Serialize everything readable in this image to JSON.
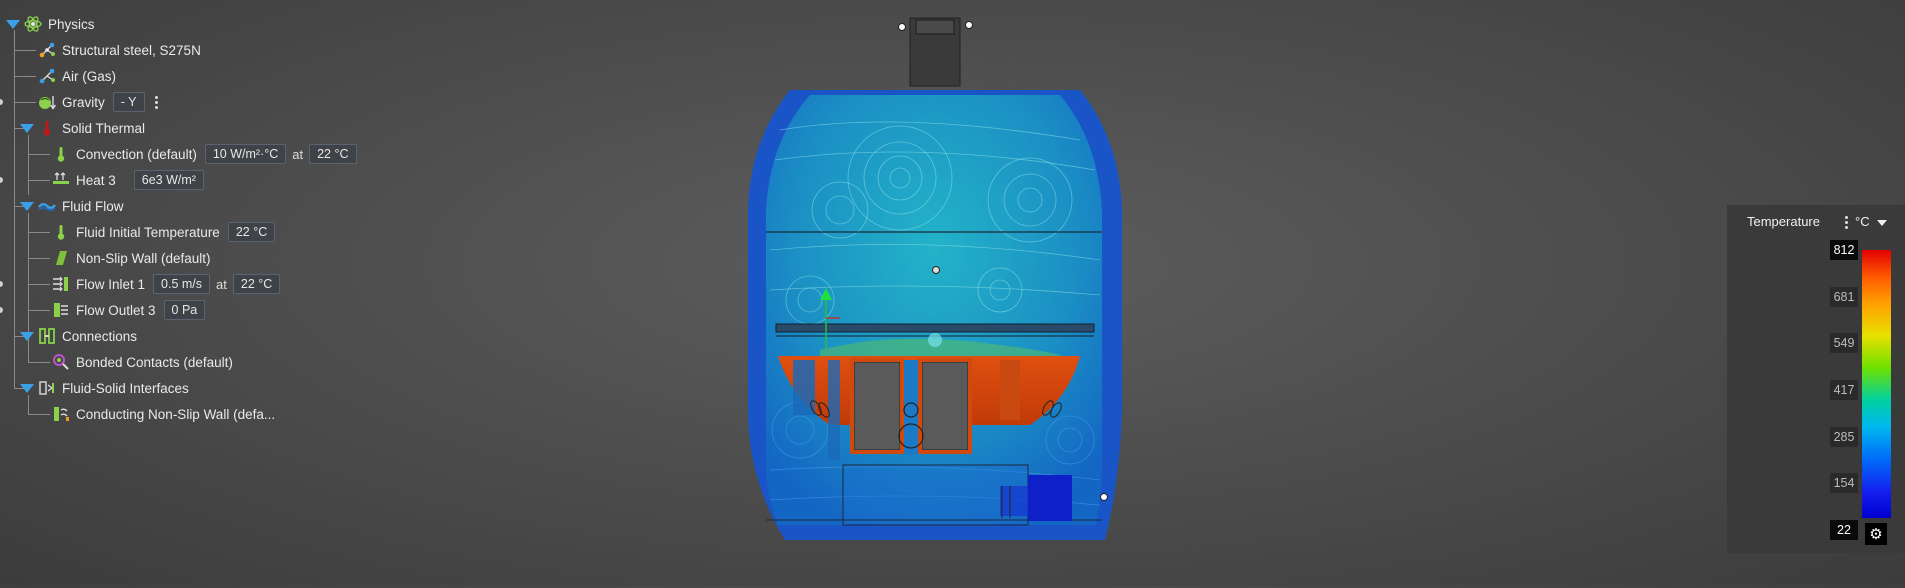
{
  "tree": {
    "physics": {
      "label": "Physics"
    },
    "steel": {
      "label": "Structural steel, S275N"
    },
    "air": {
      "label": "Air (Gas)"
    },
    "gravity": {
      "label": "Gravity",
      "value": "- Y"
    },
    "solid_thermal": {
      "label": "Solid Thermal"
    },
    "convection": {
      "label": "Convection (default)",
      "value": "10 W/m²·°C",
      "at": "at",
      "temp": "22 °C"
    },
    "heat": {
      "label": "Heat 3",
      "value": "6e3 W/m²"
    },
    "fluid_flow": {
      "label": "Fluid Flow"
    },
    "fluid_init_temp": {
      "label": "Fluid Initial Temperature",
      "value": "22 °C"
    },
    "non_slip": {
      "label": "Non-Slip Wall (default)"
    },
    "flow_inlet": {
      "label": "Flow Inlet 1",
      "value": "0.5 m/s",
      "at": "at",
      "temp": "22 °C"
    },
    "flow_outlet": {
      "label": "Flow Outlet 3",
      "value": "0 Pa"
    },
    "connections": {
      "label": "Connections"
    },
    "bonded": {
      "label": "Bonded Contacts (default)"
    },
    "fsi": {
      "label": "Fluid-Solid Interfaces"
    },
    "conducting": {
      "label": "Conducting Non-Slip Wall (defa..."
    }
  },
  "legend": {
    "title": "Temperature",
    "unit": "°C",
    "ticks": [
      "812",
      "681",
      "549",
      "417",
      "285",
      "154",
      "22"
    ]
  },
  "icons": {
    "physics": "atom-icon",
    "material": "molecule-icon",
    "gravity": "gravity-icon",
    "thermal": "thermometer-icon",
    "flow": "wave-icon",
    "settings": "gear-icon"
  }
}
